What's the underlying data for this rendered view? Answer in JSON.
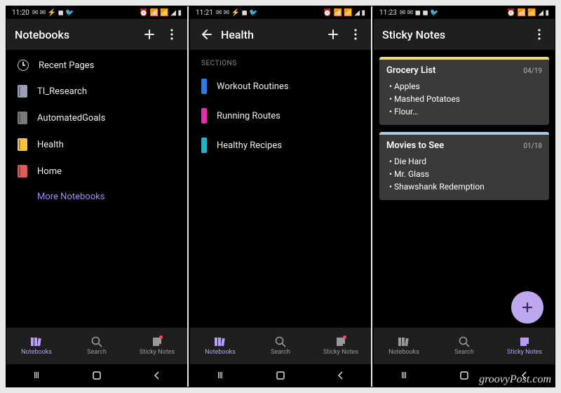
{
  "watermark": "groovyPost.com",
  "phones": [
    {
      "time": "11:20",
      "appbar": {
        "title": "Notebooks",
        "showBack": false
      },
      "recent_label": "Recent Pages",
      "notebooks": [
        {
          "name": "TI_Research",
          "color": "#9aa0b4"
        },
        {
          "name": "AutomatedGoals",
          "color": "#7a7a7a"
        },
        {
          "name": "Health",
          "color": "#f5c542"
        },
        {
          "name": "Home",
          "color": "#e05a5a"
        }
      ],
      "more_label": "More Notebooks",
      "active_tab": 0
    },
    {
      "time": "11:21",
      "appbar": {
        "title": "Health",
        "showBack": true
      },
      "sections_label": "SECTIONS",
      "sections": [
        {
          "name": "Workout Routines",
          "color": "#2a7de1"
        },
        {
          "name": "Running Routes",
          "color": "#e52fb0"
        },
        {
          "name": "Healthy Recipes",
          "color": "#1fb6c9"
        }
      ],
      "active_tab": 0
    },
    {
      "time": "11:23",
      "appbar": {
        "title": "Sticky Notes",
        "showBack": false,
        "hidePlus": true
      },
      "notes": [
        {
          "title": "Grocery List",
          "date": "04/19",
          "stripe": "#f0d97a",
          "items": [
            "Apples",
            "Mashed Potatoes",
            "Flour…"
          ]
        },
        {
          "title": "Movies to See",
          "date": "01/18",
          "stripe": "#a8c8e8",
          "items": [
            "Die Hard",
            "Mr. Glass",
            "Shawshank Redemption"
          ]
        }
      ],
      "fab": true,
      "active_tab": 2
    }
  ],
  "tabs": [
    {
      "label": "Notebooks"
    },
    {
      "label": "Search"
    },
    {
      "label": "Sticky Notes"
    }
  ]
}
